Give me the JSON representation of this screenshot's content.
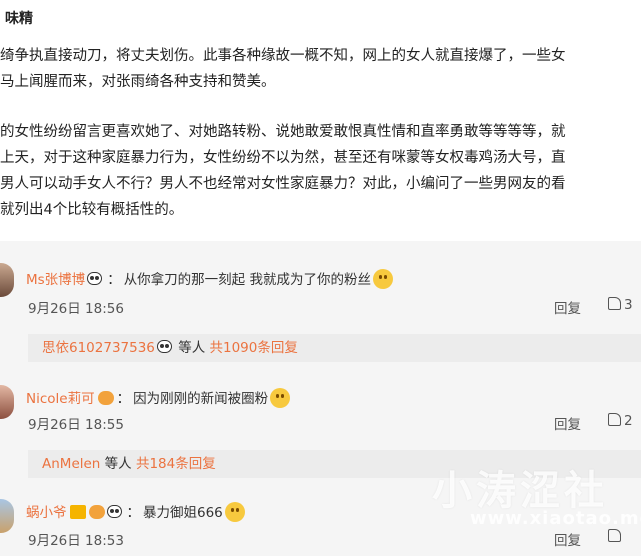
{
  "source": "味精",
  "paragraph1": [
    "绮争执直接动刀，将丈夫划伤。此事各种缘故一概不知，网上的女人就直接爆了，一些女",
    "马上闻腥而来，对张雨绮各种支持和赞美。"
  ],
  "paragraph2": [
    "的女性纷纷留言更喜欢她了、对她路转粉、说她敢爱敢恨真性情和直率勇敢等等等等，就",
    "上天，对于这种家庭暴力行为，女性纷纷不以为然，甚至还有咪蒙等女权毒鸡汤大号，直",
    "男人可以动手女人不行？男人不也经常对女性家庭暴力？对此，小编问了一些男网友的看",
    "就列出4个比较有概括性的。"
  ],
  "comments": [
    {
      "name": "Ms张博博",
      "colon": "：",
      "text": "从你拿刀的那一刻起 我就成为了你的粉丝",
      "time": "9月26日 18:56",
      "reply_label": "回复",
      "likes": "3",
      "sub": {
        "name": "思依6102737536",
        "mid": "等人",
        "count": "共1090条回复"
      }
    },
    {
      "name": "Nicole莉可",
      "colon": "：",
      "text": "因为刚刚的新闻被圈粉",
      "time": "9月26日 18:55",
      "reply_label": "回复",
      "likes": "2",
      "sub": {
        "name": "AnMelen",
        "mid": "等人",
        "count": "共184条回复"
      }
    },
    {
      "name": "蜗小爷",
      "colon": "：",
      "text": "暴力御姐666",
      "time": "9月26日 18:53",
      "reply_label": "回复",
      "likes": "",
      "sub": null
    }
  ],
  "watermark": {
    "brand": "小涛涩社",
    "url": "www.xiaotao.me"
  },
  "colors": {
    "accent": "#eb7340",
    "comment_bg": "#f5f5f5",
    "sub_bg": "#ececec"
  }
}
